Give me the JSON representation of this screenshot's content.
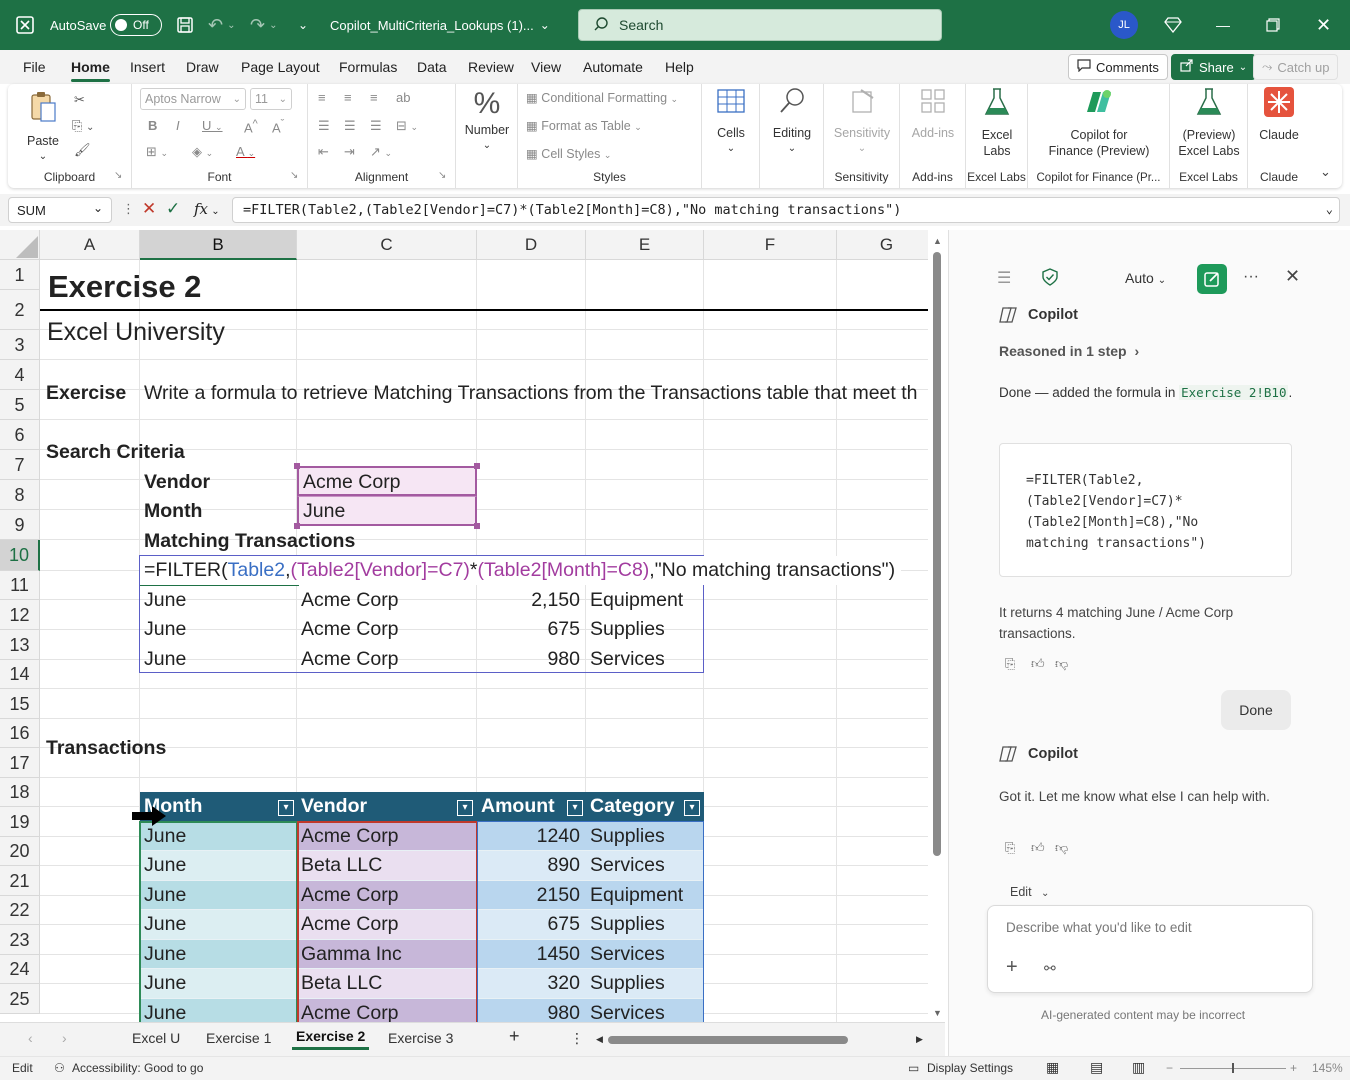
{
  "titlebar": {
    "autosave_label": "AutoSave",
    "autosave_state": "Off",
    "filename": "Copilot_MultiCriteria_Lookups (1)...",
    "search_placeholder": "Search",
    "user_initials": "JL",
    "accent": "#1e7145"
  },
  "menu": {
    "tabs": [
      "File",
      "Home",
      "Insert",
      "Draw",
      "Page Layout",
      "Formulas",
      "Data",
      "Review",
      "View",
      "Automate",
      "Help"
    ],
    "active": "Home",
    "comments_label": "Comments",
    "share_label": "Share",
    "catchup_label": "Catch up"
  },
  "ribbon": {
    "paste": "Paste",
    "clipboard": "Clipboard",
    "font_name": "Aptos Narrow",
    "font_size": "11",
    "font": "Font",
    "alignment": "Alignment",
    "number": "Number",
    "conditional_formatting": "Conditional Formatting",
    "format_as_table": "Format as Table",
    "cell_styles": "Cell Styles",
    "styles": "Styles",
    "cells": "Cells",
    "editing": "Editing",
    "sensitivity": "Sensitivity",
    "sensitivity_group": "Sensitivity",
    "addins": "Add-ins",
    "addins_group": "Add-ins",
    "excel_labs_l1": "Excel",
    "excel_labs_l2": "Labs",
    "excel_labs_group": "Excel Labs",
    "copilot_fin_l1": "Copilot for",
    "copilot_fin_l2": "Finance (Preview)",
    "copilot_fin_group": "Copilot for Finance (Pr...",
    "preview_labs_l1": "(Preview)",
    "preview_labs_l2": "Excel Labs",
    "preview_labs_group": "Excel Labs",
    "claude": "Claude",
    "claude_group": "Claude"
  },
  "formula_bar": {
    "name_box": "SUM",
    "fx": "fx",
    "formula": "=FILTER(Table2,(Table2[Vendor]=C7)*(Table2[Month]=C8),\"No matching transactions\")"
  },
  "grid": {
    "columns": [
      "A",
      "B",
      "C",
      "D",
      "E",
      "F",
      "G"
    ],
    "rows": [
      "1",
      "2",
      "3",
      "4",
      "5",
      "6",
      "7",
      "8",
      "9",
      "10",
      "11",
      "12",
      "13",
      "14",
      "15",
      "16",
      "17",
      "18",
      "19",
      "20",
      "21",
      "22",
      "23",
      "24",
      "25"
    ],
    "title": "Exercise 2",
    "subtitle": "Excel University",
    "exercise_label": "Exercise",
    "exercise_text": "Write a formula to retrieve Matching Transactions from the Transactions table that meet th",
    "search_criteria": "Search Criteria",
    "vendor_label": "Vendor",
    "vendor_value": "Acme Corp",
    "month_label": "Month",
    "month_value": "June",
    "matching_label": "Matching Transactions",
    "formula_parts": {
      "p1": "=FILTER(",
      "p2": "Table2",
      "p3": ",",
      "p4": "(Table2[Vendor]=C7)",
      "p5": "*",
      "p6": "(Table2[Month]=C8)",
      "p7": ",\"No matching transactions\")"
    },
    "results": [
      {
        "month": "June",
        "vendor": "Acme Corp",
        "amount": "2,150",
        "category": "Equipment"
      },
      {
        "month": "June",
        "vendor": "Acme Corp",
        "amount": "675",
        "category": "Supplies"
      },
      {
        "month": "June",
        "vendor": "Acme Corp",
        "amount": "980",
        "category": "Services"
      }
    ],
    "transactions_label": "Transactions",
    "table_headers": [
      "Month",
      "Vendor",
      "Amount",
      "Category"
    ],
    "transactions": [
      {
        "month": "June",
        "vendor": "Acme Corp",
        "amount": "1240",
        "category": "Supplies"
      },
      {
        "month": "June",
        "vendor": "Beta LLC",
        "amount": "890",
        "category": "Services"
      },
      {
        "month": "June",
        "vendor": "Acme Corp",
        "amount": "2150",
        "category": "Equipment"
      },
      {
        "month": "June",
        "vendor": "Acme Corp",
        "amount": "675",
        "category": "Supplies"
      },
      {
        "month": "June",
        "vendor": "Gamma Inc",
        "amount": "1450",
        "category": "Services"
      },
      {
        "month": "June",
        "vendor": "Beta LLC",
        "amount": "320",
        "category": "Supplies"
      },
      {
        "month": "June",
        "vendor": "Acme Corp",
        "amount": "980",
        "category": "Services"
      }
    ]
  },
  "sheets": {
    "tabs": [
      "Excel U",
      "Exercise 1",
      "Exercise 2",
      "Exercise 3"
    ],
    "active": "Exercise 2"
  },
  "status": {
    "mode": "Edit",
    "accessibility": "Accessibility: Good to go",
    "display_settings": "Display Settings",
    "zoom": "145%"
  },
  "copilot": {
    "mode": "Auto",
    "title": "Copilot",
    "reasoned": "Reasoned in 1 step",
    "done_text": "Done — added the formula in",
    "done_ref": "Exercise 2!B10",
    "done_period": ".",
    "code": "=FILTER(Table2,\n(Table2[Vendor]=C7)*\n(Table2[Month]=C8),\"No\nmatching transactions\")",
    "returns_text": "It returns 4 matching June / Acme Corp transactions.",
    "user_msg": "Done",
    "title2": "Copilot",
    "reply": "Got it. Let me know what else I can help with.",
    "edit_label": "Edit",
    "input_placeholder": "Describe what you'd like to edit",
    "disclaimer": "AI-generated content may be incorrect"
  }
}
